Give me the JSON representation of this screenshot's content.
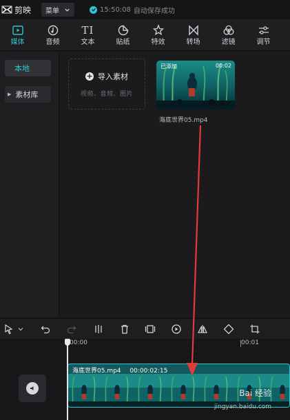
{
  "app": {
    "name": "剪映"
  },
  "topbar": {
    "menu_label": "菜单",
    "save_time": "15:50:08",
    "save_text": "自动保存成功"
  },
  "tool_tabs": [
    {
      "label": "媒体",
      "icon": "media-icon",
      "active": true
    },
    {
      "label": "音频",
      "icon": "audio-icon"
    },
    {
      "label": "文本",
      "icon": "text-icon"
    },
    {
      "label": "贴纸",
      "icon": "sticker-icon"
    },
    {
      "label": "特效",
      "icon": "effects-icon"
    },
    {
      "label": "转场",
      "icon": "transition-icon"
    },
    {
      "label": "滤镜",
      "icon": "filter-icon"
    },
    {
      "label": "调节",
      "icon": "adjust-icon"
    }
  ],
  "sidebar": {
    "local": "本地",
    "library": "素材库"
  },
  "media": {
    "import_label": "导入素材",
    "import_hint": "视频、音频、图片",
    "clip": {
      "added_badge": "已添加",
      "duration": "00:02",
      "filename": "海底世界05.mp4"
    }
  },
  "timeline": {
    "ruler": {
      "start": "00:00",
      "end": "00:01"
    },
    "track_clip": {
      "filename": "海底世界05.mp4",
      "duration": "00:00:02:15"
    }
  },
  "watermark": {
    "text": "Bai 经验",
    "url": "jingyan.baidu.com"
  },
  "colors": {
    "accent": "#2fc4d0",
    "arrow": "#e23b3b"
  }
}
